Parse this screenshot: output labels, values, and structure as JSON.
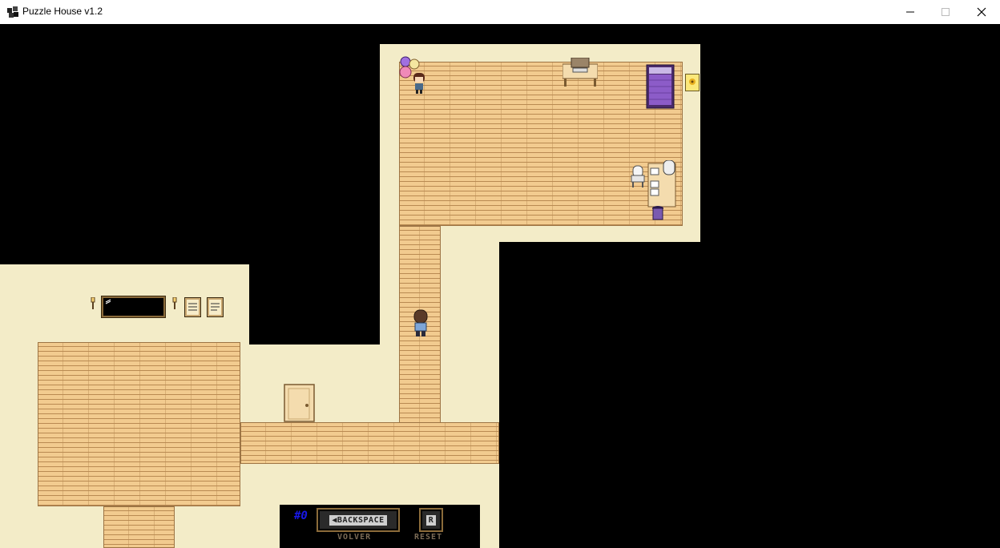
{
  "window": {
    "title": "Puzzle House v1.2",
    "minimize_icon": "minimize-icon",
    "maximize_icon": "maximize-icon",
    "close_icon": "close-icon"
  },
  "colors": {
    "wall": "#f3ecc8",
    "floor": "#f2cb8f",
    "void": "#000000",
    "hud_counter": "#1818e8"
  },
  "hud": {
    "move_counter": "#0",
    "backspace_key": "BACKSPACE",
    "backspace_action": "VOLVER",
    "reset_key": "R",
    "reset_action": "RESET"
  }
}
